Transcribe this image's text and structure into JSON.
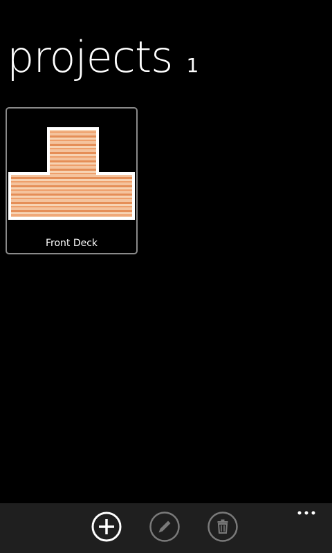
{
  "header": {
    "title": "projects",
    "count": "1"
  },
  "projects": [
    {
      "name": "Front Deck",
      "preview_icon": "deck-shape-preview"
    }
  ],
  "appbar": {
    "buttons": [
      {
        "icon": "plus-icon",
        "state": "enabled"
      },
      {
        "icon": "pencil-icon",
        "state": "disabled"
      },
      {
        "icon": "trash-icon",
        "state": "disabled"
      }
    ],
    "more_icon": "ellipsis-icon"
  },
  "colors": {
    "background": "#000000",
    "appbar": "#1f1f1f",
    "enabled_icon": "#ffffff",
    "disabled_icon": "#7a7a7a",
    "wood_light": "#f4c9a4",
    "wood_dark": "#e7955f"
  }
}
